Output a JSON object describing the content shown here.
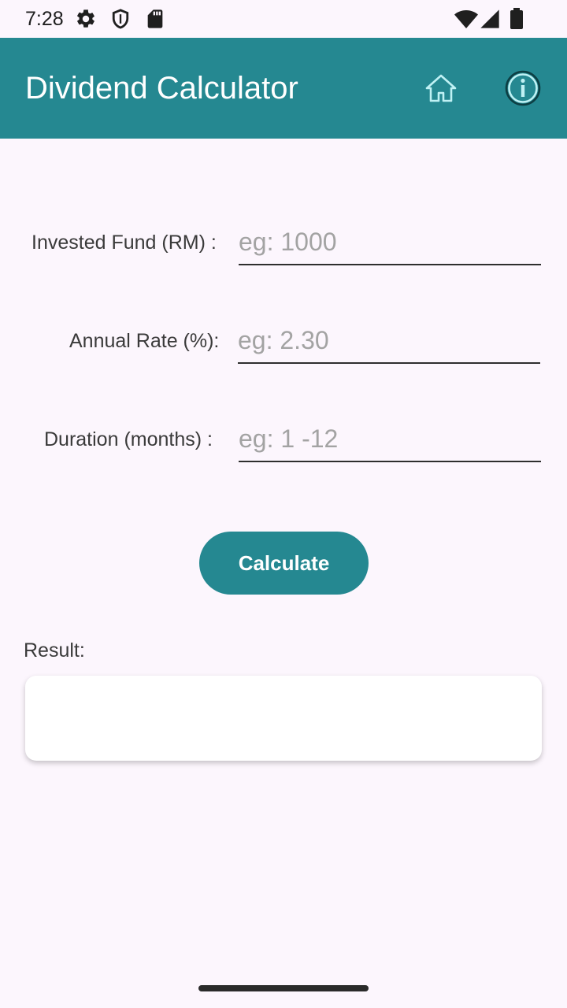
{
  "status_bar": {
    "time": "7:28",
    "icons": [
      "gear-icon",
      "shield-icon",
      "sd-card-icon",
      "wifi-icon",
      "cell-signal-icon",
      "battery-icon"
    ]
  },
  "app_bar": {
    "title": "Dividend Calculator",
    "icons": [
      "home-icon",
      "info-icon"
    ],
    "background_color": "#258891"
  },
  "form": {
    "invested_fund": {
      "label": "Invested Fund (RM) :",
      "placeholder": "eg: 1000",
      "value": ""
    },
    "annual_rate": {
      "label": "Annual Rate (%):",
      "placeholder": "eg: 2.30",
      "value": ""
    },
    "duration": {
      "label": "Duration (months) :",
      "placeholder": "eg: 1 -12",
      "value": ""
    }
  },
  "calculate_button": {
    "label": "Calculate",
    "color": "#258891"
  },
  "result": {
    "label": "Result:",
    "value": ""
  }
}
